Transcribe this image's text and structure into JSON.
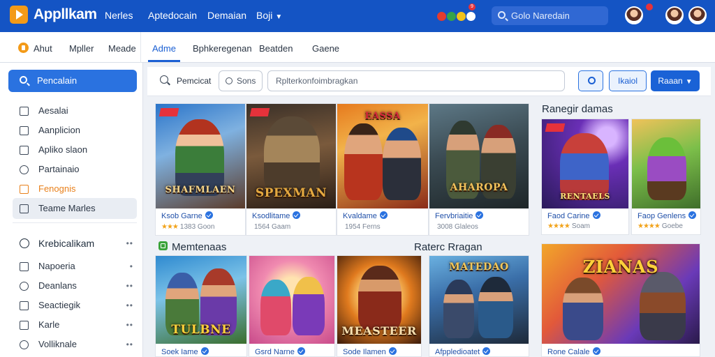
{
  "header": {
    "logo": "Appllkam",
    "nav": [
      "Nerles",
      "Aptedocain",
      "Demaian",
      "Boji"
    ],
    "search_placeholder": "Golo Naredain",
    "notification_count": "9"
  },
  "subnav": {
    "items": [
      "Ahut",
      "Mpller",
      "Meade",
      "Adme",
      "Bphkeregenan",
      "Beatden",
      "Gaene"
    ],
    "active_index": 3
  },
  "sidebar": {
    "search_label": "Pencalain",
    "items": [
      "Aesalai",
      "Aanplicion",
      "Apliko slaon",
      "Partainaio",
      "Fenognis",
      "Teame Marles"
    ],
    "section_header": "Krebicalikam",
    "section_items": [
      "Napoeria",
      "Deanlans",
      "Seactiegik",
      "Karle",
      "Volliknale"
    ]
  },
  "filters": {
    "label": "Pemcicat",
    "chip": "Sons",
    "query_placeholder": "Rplterkonfoimbragkan",
    "action_outline": "Ikaiol",
    "action_primary": "Raaan"
  },
  "sections": {
    "right_title": "Ranegir damas",
    "lower_left_title": "Memtenaas",
    "lower_mid_title": "Raterc Rragan"
  },
  "cards_row1": [
    {
      "title": "SHAFMLAEN",
      "name": "Ksob Garne",
      "meta": "1383 Goon",
      "rating": "★★★"
    },
    {
      "title": "SPEXMAN",
      "name": "Ksodlitame",
      "meta": "1564 Gaam",
      "rating": ""
    },
    {
      "title": "EASSA",
      "name": "Kvaldame",
      "meta": "1954 Ferns",
      "rating": ""
    },
    {
      "title": "AHAROPA",
      "name": "Fervbriaitie",
      "meta": "3008 Glaleos",
      "rating": ""
    }
  ],
  "cards_right": [
    {
      "title": "RENTAELS",
      "name": "Faod Carine",
      "meta": "Soam",
      "rating": "★★★★"
    },
    {
      "title": "",
      "name": "Faop Genlens",
      "meta": "Goebe",
      "rating": "★★★★"
    }
  ],
  "cards_row2": [
    {
      "title": "TULBNE",
      "name": "Soek Iame",
      "meta": "",
      "rating": ""
    },
    {
      "title": "",
      "name": "Gsrd Narne",
      "meta": "",
      "rating": ""
    },
    {
      "title": "MEASTEER",
      "name": "Sode Ilamen",
      "meta": "",
      "rating": ""
    },
    {
      "title": "MATEDAO",
      "name": "Afppledioatet",
      "meta": "",
      "rating": ""
    },
    {
      "title": "ZIANAS",
      "name": "Rone Calale",
      "meta": "",
      "rating": ""
    }
  ]
}
